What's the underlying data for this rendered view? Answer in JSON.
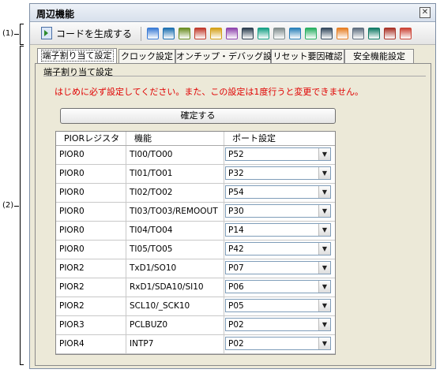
{
  "callouts": {
    "one": "(1)",
    "two": "(2)"
  },
  "window": {
    "title": "周辺機能",
    "close_icon": "close-icon"
  },
  "toolbar": {
    "generate_label": "コードを生成する",
    "icons": [
      "clock-gen-icon",
      "port-icon",
      "timer-icon",
      "watchdog-icon",
      "ad-converter-icon",
      "serial-icon",
      "interrupt-icon",
      "sound-icon",
      "link-icon",
      "lcd-icon",
      "pwm-icon",
      "dma-icon",
      "bcd-icon",
      "memory-icon",
      "data-flash-icon",
      "lvd-icon",
      "reset-icon"
    ]
  },
  "tabs": [
    {
      "label": "端子割り当て設定",
      "active": true
    },
    {
      "label": "クロック設定",
      "active": false
    },
    {
      "label": "オンチップ・デバッグ設定",
      "active": false
    },
    {
      "label": "リセット要因確認",
      "active": false
    },
    {
      "label": "安全機能設定",
      "active": false
    }
  ],
  "group": {
    "label": "端子割り当て設定",
    "notice": "はじめに必ず設定してください。また、この設定は1度行うと変更できません。",
    "confirm_label": "確定する"
  },
  "table": {
    "headers": [
      "PIORレジスタ",
      "機能",
      "ポート設定"
    ],
    "rows": [
      {
        "reg": "PIOR0",
        "func": "TI00/TO00",
        "port": "P52"
      },
      {
        "reg": "PIOR0",
        "func": "TI01/TO01",
        "port": "P32"
      },
      {
        "reg": "PIOR0",
        "func": "TI02/TO02",
        "port": "P54"
      },
      {
        "reg": "PIOR0",
        "func": "TI03/TO03/REMOOUT",
        "port": "P30"
      },
      {
        "reg": "PIOR0",
        "func": "TI04/TO04",
        "port": "P14"
      },
      {
        "reg": "PIOR0",
        "func": "TI05/TO05",
        "port": "P42"
      },
      {
        "reg": "PIOR2",
        "func": "TxD1/SO10",
        "port": "P07"
      },
      {
        "reg": "PIOR2",
        "func": "RxD1/SDA10/SI10",
        "port": "P06"
      },
      {
        "reg": "PIOR2",
        "func": "SCL10/_SCK10",
        "port": "P05"
      },
      {
        "reg": "PIOR3",
        "func": "PCLBUZ0",
        "port": "P02"
      },
      {
        "reg": "PIOR4",
        "func": "INTP7",
        "port": "P02"
      }
    ]
  },
  "colors": {
    "notice": "#e00000",
    "panel_bg": "#ece9d8"
  }
}
